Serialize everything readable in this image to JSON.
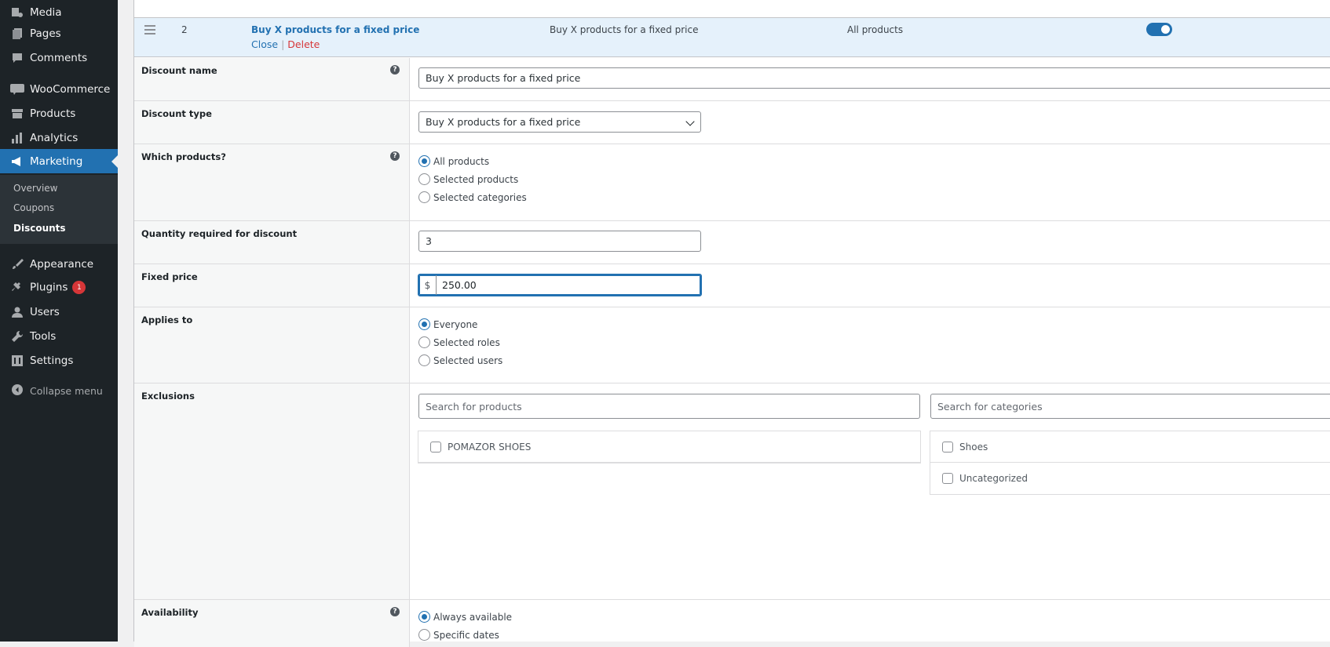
{
  "sidebar": {
    "items": [
      {
        "label": "Media",
        "icon": "media-icon"
      },
      {
        "label": "Pages",
        "icon": "pages-icon"
      },
      {
        "label": "Comments",
        "icon": "comments-icon"
      },
      {
        "label": "WooCommerce",
        "icon": "woocommerce-icon"
      },
      {
        "label": "Products",
        "icon": "products-icon"
      },
      {
        "label": "Analytics",
        "icon": "analytics-icon"
      },
      {
        "label": "Marketing",
        "icon": "megaphone-icon"
      },
      {
        "label": "Appearance",
        "icon": "brush-icon"
      },
      {
        "label": "Plugins",
        "icon": "plug-icon"
      },
      {
        "label": "Users",
        "icon": "user-icon"
      },
      {
        "label": "Tools",
        "icon": "wrench-icon"
      },
      {
        "label": "Settings",
        "icon": "settings-icon"
      }
    ],
    "submenu": [
      "Overview",
      "Coupons",
      "Discounts"
    ],
    "plugins_badge": "1",
    "collapse_label": "Collapse menu"
  },
  "rule_header": {
    "order": "2",
    "name": "Buy X products for a fixed price",
    "close_label": "Close",
    "separator": "|",
    "delete_label": "Delete",
    "type": "Buy X products for a fixed price",
    "scope": "All products",
    "enabled": true
  },
  "form": {
    "discount_name": {
      "label": "Discount name",
      "value": "Buy X products for a fixed price"
    },
    "discount_type": {
      "label": "Discount type",
      "value": "Buy X products for a fixed price"
    },
    "which_products": {
      "label": "Which products?",
      "options": [
        "All products",
        "Selected products",
        "Selected categories"
      ],
      "selected": "All products"
    },
    "quantity": {
      "label": "Quantity required for discount",
      "value": "3"
    },
    "fixed_price": {
      "label": "Fixed price",
      "currency": "$",
      "value": "250.00"
    },
    "applies_to": {
      "label": "Applies to",
      "options": [
        "Everyone",
        "Selected roles",
        "Selected users"
      ],
      "selected": "Everyone"
    },
    "exclusions": {
      "label": "Exclusions",
      "products_placeholder": "Search for products",
      "categories_placeholder": "Search for categories",
      "products": [
        "POMAZOR SHOES"
      ],
      "categories": [
        "Shoes",
        "Uncategorized"
      ]
    },
    "availability": {
      "label": "Availability",
      "options": [
        "Always available",
        "Specific dates"
      ],
      "selected": "Always available"
    }
  },
  "colors": {
    "accent": "#2271b1",
    "sidebar_bg": "#1d2327",
    "danger": "#d63638"
  }
}
